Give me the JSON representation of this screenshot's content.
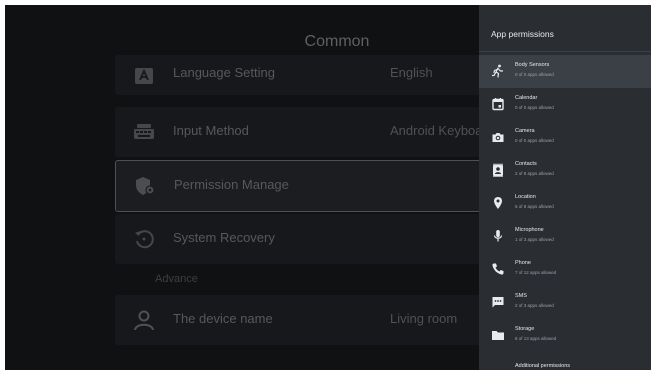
{
  "background": {
    "title": "Common",
    "items": [
      {
        "label": "Language Setting",
        "value": "English"
      },
      {
        "label": "Input Method",
        "value": "Android Keyboard"
      },
      {
        "label": "Permission Manage",
        "value": ""
      },
      {
        "label": "System Recovery",
        "value": ""
      }
    ],
    "section_label": "Advance",
    "device_item": {
      "label": "The device name",
      "value": "Living room"
    }
  },
  "panel": {
    "title": "App permissions",
    "items": [
      {
        "name": "Body Sensors",
        "desc": "0 of 0 apps allowed",
        "icon": "run-icon"
      },
      {
        "name": "Calendar",
        "desc": "0 of 0 apps allowed",
        "icon": "calendar-icon"
      },
      {
        "name": "Camera",
        "desc": "0 of 0 apps allowed",
        "icon": "camera-icon"
      },
      {
        "name": "Contacts",
        "desc": "2 of 8 apps allowed",
        "icon": "contacts-icon"
      },
      {
        "name": "Location",
        "desc": "5 of 8 apps allowed",
        "icon": "location-icon"
      },
      {
        "name": "Microphone",
        "desc": "1 of 3 apps allowed",
        "icon": "microphone-icon"
      },
      {
        "name": "Phone",
        "desc": "7 of 12 apps allowed",
        "icon": "phone-icon"
      },
      {
        "name": "SMS",
        "desc": "2 of 3 apps allowed",
        "icon": "sms-icon"
      },
      {
        "name": "Storage",
        "desc": "8 of 13 apps allowed",
        "icon": "folder-icon"
      },
      {
        "name": "Additional permissions",
        "desc": "",
        "icon": "list-icon"
      }
    ]
  }
}
